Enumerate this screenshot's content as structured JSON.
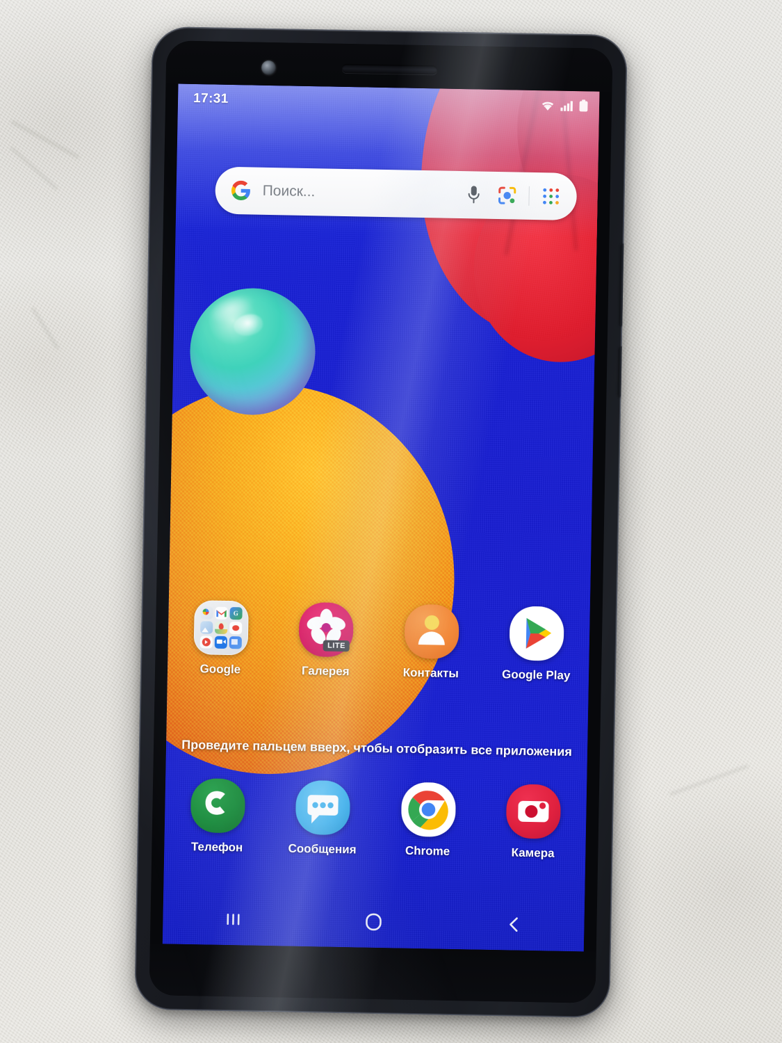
{
  "device": {
    "kind": "smartphone",
    "brand_style": "samsung-galaxy",
    "orientation": "portrait",
    "body_color": "#1a1c22",
    "bezel_color": "#07080b"
  },
  "status_bar": {
    "clock": "17:31",
    "icons": [
      {
        "name": "wifi-icon",
        "label": "Wi-Fi"
      },
      {
        "name": "cellular-signal-icon",
        "label": "Signal"
      },
      {
        "name": "battery-icon",
        "label": "Battery"
      }
    ]
  },
  "search_widget": {
    "placeholder": "Поиск...",
    "logo": "google-g-icon",
    "buttons": [
      {
        "name": "voice-search-button",
        "icon": "microphone-icon"
      },
      {
        "name": "google-lens-button",
        "icon": "lens-icon"
      },
      {
        "name": "app-grid-button",
        "icon": "grid-dots-icon"
      }
    ]
  },
  "home_screen": {
    "swipe_hint": "Проведите пальцем вверх, чтобы отобразить все приложения",
    "wallpaper": {
      "background_color": "#1a1fd4",
      "accent_orange": "#f2901a",
      "accent_red": "#e8202f",
      "accent_teal": "#3fd2bb"
    },
    "apps": [
      {
        "name": "app-google-folder",
        "label": "Google",
        "icon": "folder-icon",
        "type": "folder",
        "bg": "#e8eaee"
      },
      {
        "name": "app-gallery",
        "label": "Галерея",
        "icon": "gallery-flower-icon",
        "badge": "LITE",
        "bg": "#d6165e"
      },
      {
        "name": "app-contacts",
        "label": "Контакты",
        "icon": "contact-person-icon",
        "bg": "#f2893a"
      },
      {
        "name": "app-google-play",
        "label": "Google Play",
        "icon": "play-store-icon",
        "bg": "#ffffff"
      }
    ],
    "dock": [
      {
        "name": "app-phone",
        "label": "Телефон",
        "icon": "phone-handset-icon",
        "bg": "#1a8c3c"
      },
      {
        "name": "app-messages",
        "label": "Сообщения",
        "icon": "speech-bubble-icon",
        "bg": "#38b0ee"
      },
      {
        "name": "app-chrome",
        "label": "Chrome",
        "icon": "chrome-icon",
        "bg": "#ffffff"
      },
      {
        "name": "app-camera",
        "label": "Камера",
        "icon": "camera-icon",
        "bg": "#e0213f"
      }
    ]
  },
  "nav_bar": {
    "buttons": [
      {
        "name": "recents-button",
        "icon": "three-bars-icon",
        "label": "Recents"
      },
      {
        "name": "home-button",
        "icon": "circle-icon",
        "label": "Home"
      },
      {
        "name": "back-button",
        "icon": "chevron-left-icon",
        "label": "Back"
      }
    ]
  }
}
